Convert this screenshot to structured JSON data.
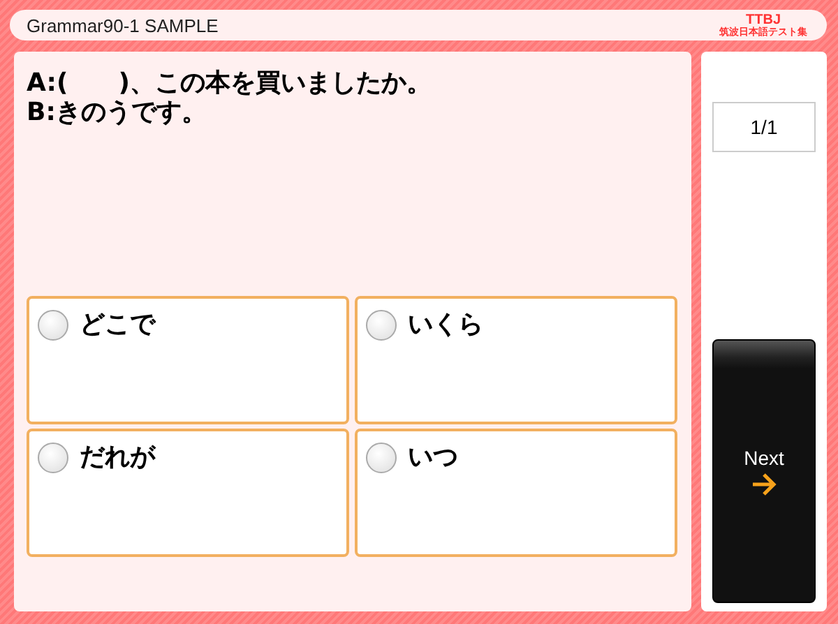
{
  "header": {
    "title": "Grammar90-1 SAMPLE",
    "logo": {
      "line_1": "TTBJ",
      "line_2": "筑波日本語テスト集"
    }
  },
  "question": {
    "lines": [
      "A:(　　)、この本を買いましたか。",
      "B:きのうです。"
    ]
  },
  "options": [
    {
      "label": "どこで",
      "selected": false
    },
    {
      "label": "いくら",
      "selected": false
    },
    {
      "label": "だれが",
      "selected": false
    },
    {
      "label": "いつ",
      "selected": false
    }
  ],
  "counter": "1/1",
  "next_button": {
    "label": "Next"
  }
}
